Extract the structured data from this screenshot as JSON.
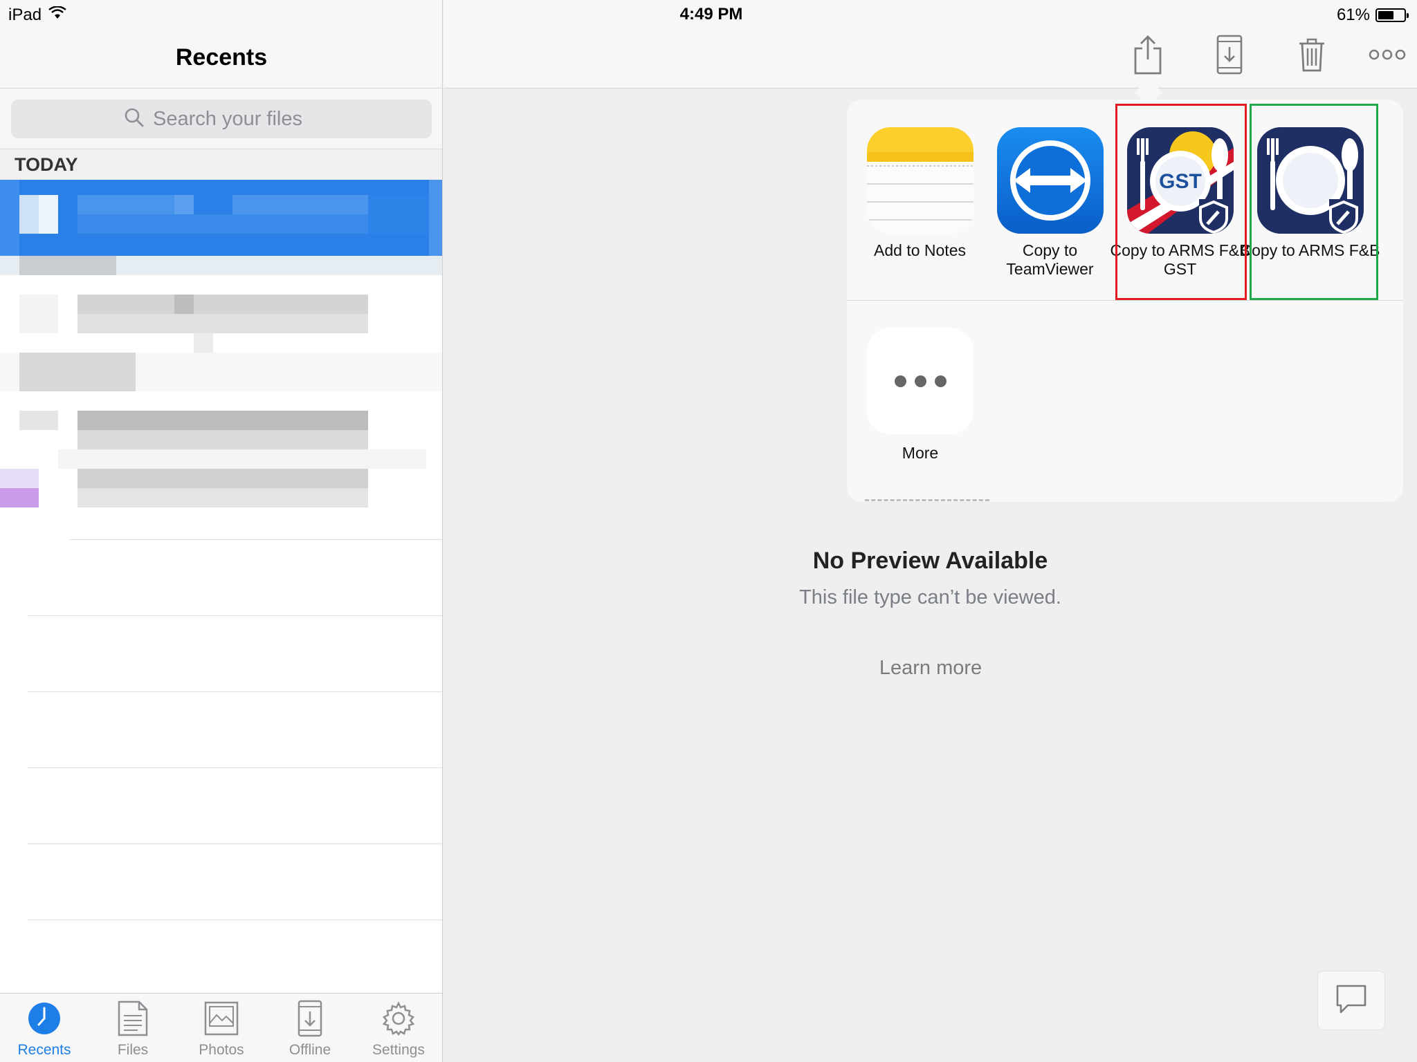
{
  "status_bar": {
    "device": "iPad",
    "time": "4:49 PM",
    "battery_percent": "61%",
    "battery_level": 0.61
  },
  "sidebar": {
    "title": "Recents",
    "search_placeholder": "Search your files",
    "section": "TODAY"
  },
  "tab_bar": {
    "items": [
      {
        "label": "Recents",
        "icon": "clock-icon",
        "active": true
      },
      {
        "label": "Files",
        "icon": "document-icon"
      },
      {
        "label": "Photos",
        "icon": "photo-icon"
      },
      {
        "label": "Offline",
        "icon": "offline-download-icon"
      },
      {
        "label": "Settings",
        "icon": "gear-icon"
      }
    ]
  },
  "toolbar": {
    "icons": [
      "share-icon",
      "save-to-device-icon",
      "trash-icon",
      "more-options-icon"
    ]
  },
  "share_sheet": {
    "apps": [
      {
        "label": "Add to Notes",
        "icon": "notes-app-icon"
      },
      {
        "label": "Copy to TeamViewer",
        "icon": "teamviewer-app-icon"
      },
      {
        "label": "Copy to ARMS F&B GST",
        "icon": "arms-fnb-gst-app-icon",
        "badge": "GST"
      },
      {
        "label": "Copy to ARMS F&B",
        "icon": "arms-fnb-app-icon"
      }
    ],
    "more_label": "More",
    "highlight_colors": {
      "red": "#e01b24",
      "green": "#1ea84a"
    }
  },
  "preview": {
    "title": "No Preview Available",
    "subtitle": "This file type can’t be viewed.",
    "learn_more": "Learn more"
  },
  "colors": {
    "accent": "#1e7ee8",
    "selected_row": "#2b80e8"
  }
}
